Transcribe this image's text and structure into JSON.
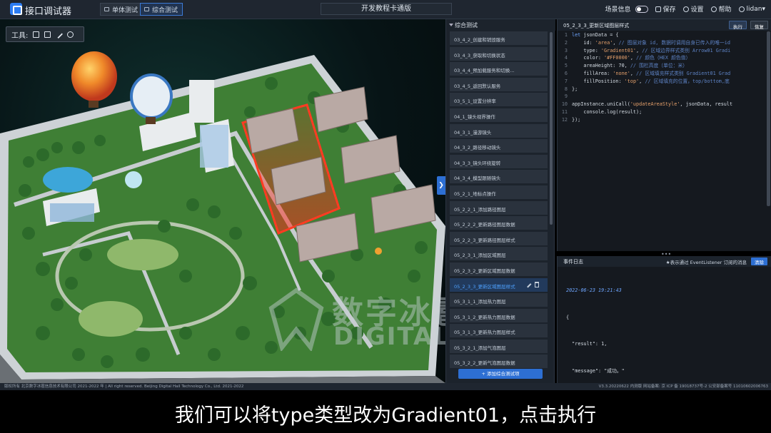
{
  "app": {
    "title": "接口调试器"
  },
  "tabs": [
    {
      "label": "单体测试"
    },
    {
      "label": "综合测试"
    }
  ],
  "center_title": "开发教程卡通版",
  "top_controls": {
    "scene_info": "场景信息",
    "save": "保存",
    "settings": "设置",
    "help": "帮助",
    "user": "lidan▾"
  },
  "toolbox": {
    "label": "工具:"
  },
  "list": {
    "header": "综合测试",
    "items": [
      "03_4_2_创建和销毁服务",
      "03_4_3_获取和切换状态",
      "03_4_4_预加载服务和切换...",
      "03_4_5_返回默认服务",
      "03_5_1_设置分辨率",
      "04_1_镜头视界操作",
      "04_3_1_漫游镜头",
      "04_3_2_路径移动镜头",
      "04_3_3_镜头环绕旋转",
      "04_3_4_模型跟随镜头",
      "05_2_1_地标点操作",
      "05_2_2_1_添加路径图层",
      "05_2_2_2_更新路径图层数据",
      "05_2_2_3_更新路径图层样式",
      "05_2_3_1_添加区域图层",
      "05_2_3_2_更新区域图层数据",
      "05_2_3_3_更新区域图层样式",
      "05_3_1_1_添加热力图层",
      "05_3_1_2_更新热力图层数据",
      "05_3_1_3_更新热力图层样式",
      "05_3_2_1_添加气泡图层",
      "05_3_2_2_更新气泡图层数据"
    ],
    "active_index": 16,
    "add_button": "+ 添加综合测试项"
  },
  "editor": {
    "title": "05_2_3_3_更新区域图层样式",
    "run": "执行",
    "reset": "恢复",
    "lines": [
      "let jsonData = {",
      "    id: 'area', // 图层对象 id, 数据时调用自身已传入的唯一id",
      "    type: 'Gradient01', // 区域边界样式类别 Arrow01 Gradi",
      "    color: '#FF0000', // 颜色（HEX 颜色值）",
      "    areaHeight: 70, // 围栏高度（单位：米）",
      "    fillArea: 'none', // 区域填充样式类别 Gradient01 Grad",
      "    fillPosition: 'top', // 区域填充的位置，top/bottom,底",
      "};",
      "",
      "appInstance.uniCall('updateAreaStyle', jsonData, result",
      "    console.log(result);",
      "});"
    ]
  },
  "log": {
    "title": "事件日志",
    "hint": "★表示通过 EventListener 订阅的消息",
    "clear": "清除",
    "timestamp": "2022-06-23 19:21:43",
    "lines": [
      "{",
      "  \"result\": 1,",
      "  \"message\": \"成功。\"",
      "}"
    ]
  },
  "watermark": {
    "cn": "数字冰雹",
    "en": "DIGITAL HAIL"
  },
  "footer": {
    "left": "版权所有 北京数字冰雹信息技术有限公司 2021-2022 年 | All right reserved. Beijing Digital Hail Technology Co., Ltd. 2021-2022",
    "right": "V3.3.20220622 内测版  网站备案: 京 ICP 备 19018737号-2 公安部备案号 11010602006763"
  },
  "subtitle": "我们可以将type类型改为Gradient01，点击执行",
  "colors": {
    "accent": "#2d6fd3",
    "highlight_area": "#ff2a1a",
    "grass": "#3f7f35",
    "active_text": "#4ea1ff"
  }
}
